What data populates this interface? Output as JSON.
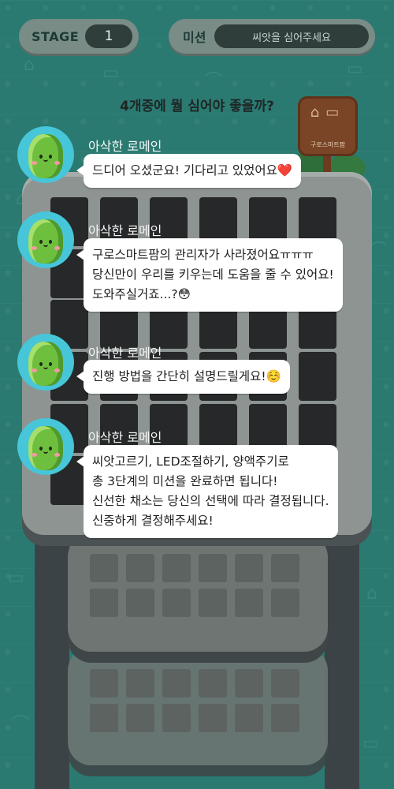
{
  "hud": {
    "stage_label": "STAGE",
    "stage_number": "1",
    "mission_label": "미션",
    "mission_text": "씨앗을 심어주세요"
  },
  "question": "4개중에 뭘 심어야 좋을까?",
  "sign": {
    "text": "구로스마트팜"
  },
  "chat": {
    "speaker": "아삭한 로메인",
    "messages": [
      {
        "lines": [
          "드디어 오셨군요! 기다리고 있었어요❤️"
        ]
      },
      {
        "lines": [
          "구로스마트팜의 관리자가 사라졌어요ㅠㅠㅠ",
          "당신만이 우리를 키우는데 도움을 줄 수 있어요!",
          "도와주실거죠...?😳"
        ]
      },
      {
        "lines": [
          "진행 방법을 간단히 설명드릴게요!☺️"
        ]
      },
      {
        "lines": [
          "씨앗고르기, LED조절하기, 양액주기로",
          "총 3단계의 미션을 완료하면 됩니다!",
          "신선한 채소는 당신의 선택에 따라 결정됩니다.",
          "신중하게 결정해주세요!"
        ]
      }
    ]
  },
  "colors": {
    "background": "#2a7a72",
    "bubble": "#ffffff",
    "avatar_bg": "#46c6d8",
    "shelf": "#8e9492"
  },
  "icons": [
    "lettuce-character-icon",
    "sign-board-icon"
  ]
}
